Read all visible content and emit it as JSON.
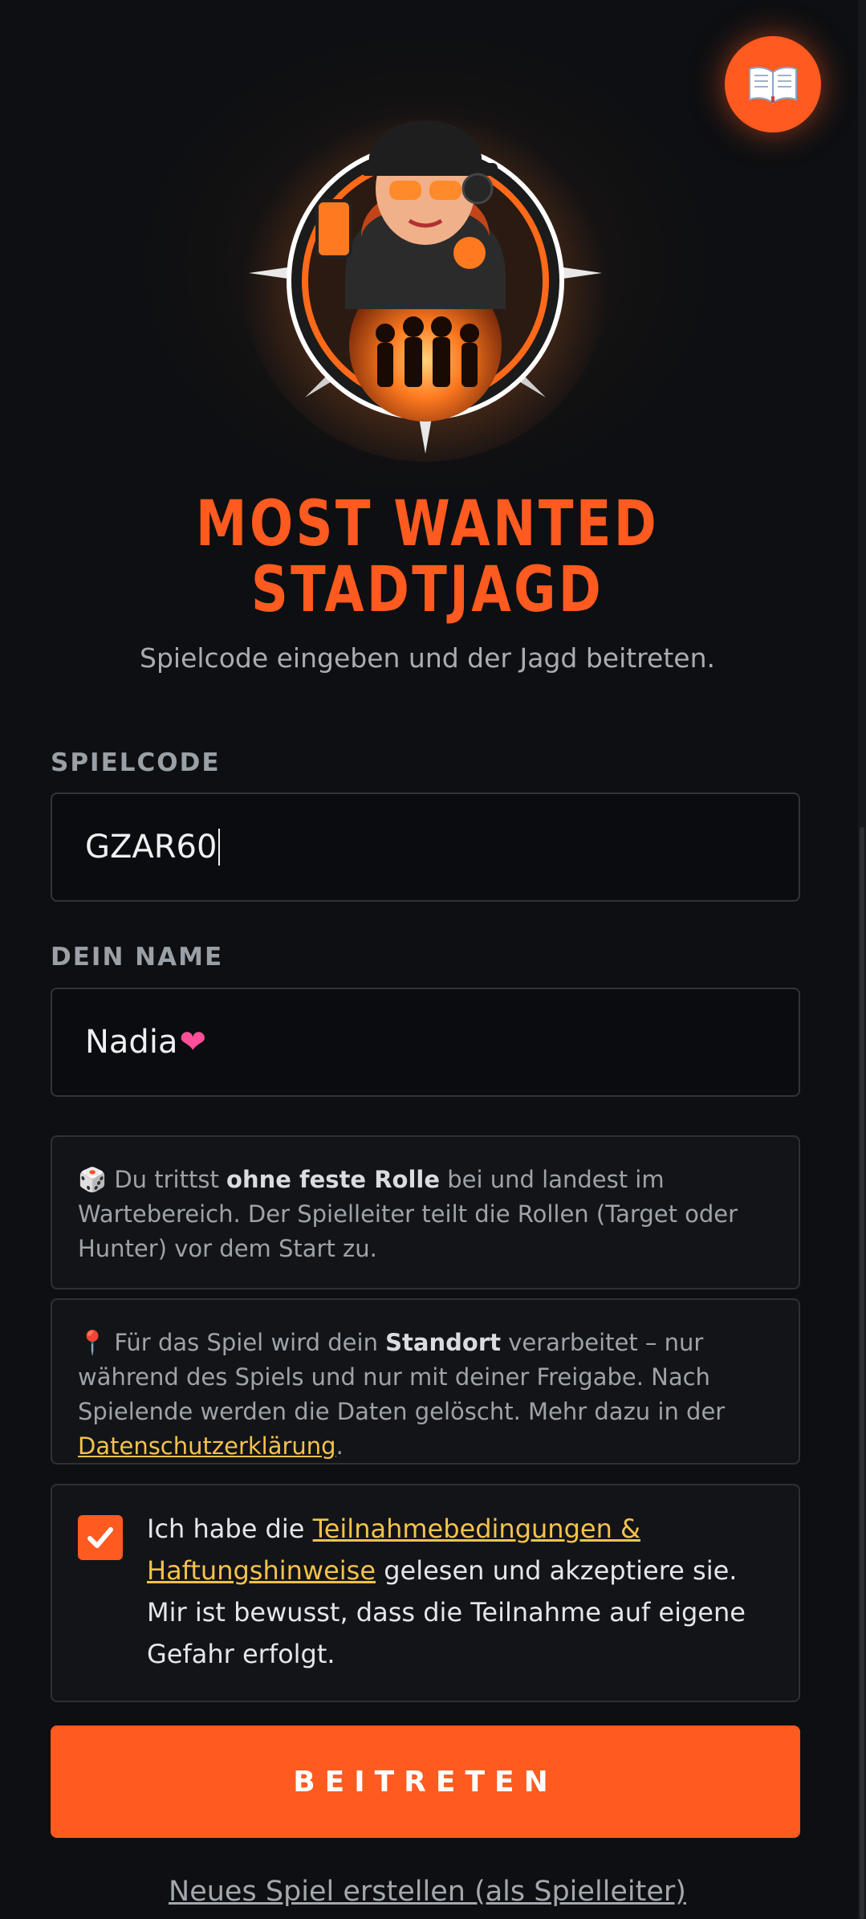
{
  "header": {
    "manual_icon": "open-book-icon",
    "logo": "game-logo-emblem"
  },
  "hero": {
    "title_line1": "MOST WANTED",
    "title_line2": "STADTJAGD",
    "subtitle": "Spielcode eingeben und der Jagd beitreten."
  },
  "form": {
    "code_label": "SPIELCODE",
    "code_value": "GZAR60",
    "name_label": "DEIN NAME",
    "name_value": "Nadia",
    "name_emoji": "❤"
  },
  "info_role": {
    "icon": "🎲",
    "pre": " Du trittst ",
    "bold": "ohne feste Rolle",
    "post": " bei und landest im Wartebereich. Der Spielleiter teilt die Rollen (Target oder Hunter) vor dem Start zu."
  },
  "info_location": {
    "icon": "📍",
    "pre": " Für das Spiel wird dein ",
    "bold": "Standort",
    "post": " verarbeitet – nur während des Spiels und nur mit deiner Freigabe. Nach Spielende werden die Daten gelöscht. Mehr dazu in der ",
    "link": "Datenschutzerklärung",
    "end": "."
  },
  "consent": {
    "checked": true,
    "pre": "Ich habe die ",
    "link": "Teilnahmebedingungen & Haftungshinweise",
    "post": " gelesen und akzeptiere sie. Mir ist bewusst, dass die Teilnahme auf eigene Gefahr erfolgt."
  },
  "actions": {
    "join_label": "BEITRETEN",
    "new_game_label": "Neues Spiel erstellen (als Spielleiter)"
  },
  "colors": {
    "accent": "#ff5a1f",
    "link": "#f5c24b",
    "background": "#0d0f12"
  }
}
